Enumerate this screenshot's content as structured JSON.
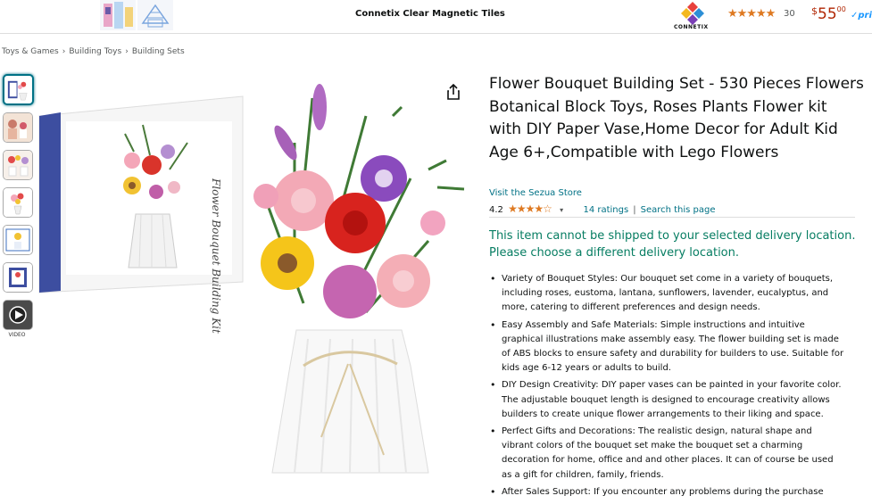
{
  "ad_banner": {
    "title": "Connetix Clear Magnetic Tiles",
    "brand": "CONNETIX",
    "stars": "★★★★★",
    "rating_count": "30",
    "price_symbol": "$",
    "price_whole": "55",
    "price_fraction": "00",
    "prime": "✓prim"
  },
  "breadcrumb": [
    "Toys & Games",
    "Building Toys",
    "Building Sets"
  ],
  "breadcrumb_sep": "›",
  "thumbnails": {
    "count": 7,
    "active_index": 0,
    "video_label": "VIDEO"
  },
  "product": {
    "title": "Flower Bouquet Building Set - 530 Pieces Flowers Botanical Block Toys, Roses Plants Flower kit with DIY Paper Vase,Home Decor for Adult Kid Age 6+,Compatible with Lego Flowers",
    "store_link": "Visit the Sezua Store",
    "rating_value": "4.2",
    "rating_stars": "★★★★☆",
    "ratings_link": "14 ratings",
    "search_link": "Search this page",
    "shipping_message": "This item cannot be shipped to your selected delivery location. Please choose a different delivery location.",
    "box_text": "Flower Bouquet Building Kit",
    "bullets": [
      "Variety of Bouquet Styles: Our bouquet set come in a variety of bouquets, including roses, eustoma, lantana, sunflowers, lavender, eucalyptus, and more, catering to different preferences and design needs.",
      "Easy Assembly and Safe Materials: Simple instructions and intuitive graphical illustrations make assembly easy. The flower building set is made of ABS blocks to ensure safety and durability for builders to use. Suitable for kids age 6-12 years or adults to build.",
      "DIY Design Creativity: DIY paper vases can be painted in your favorite color. The adjustable bouquet length is designed to encourage creativity allows builders to create unique flower arrangements to their liking and space.",
      "Perfect Gifts and Decorations: The realistic design, natural shape and vibrant colors of the bouquet set make the bouquet set a charming decoration for home, office and and other places. It can of course be used as a gift for children, family, friends.",
      "After Sales Support: If you encounter any problems during the purchase"
    ]
  },
  "colors": {
    "link": "#007185",
    "star": "#de7921",
    "price": "#b12704",
    "availability": "#067d62"
  }
}
